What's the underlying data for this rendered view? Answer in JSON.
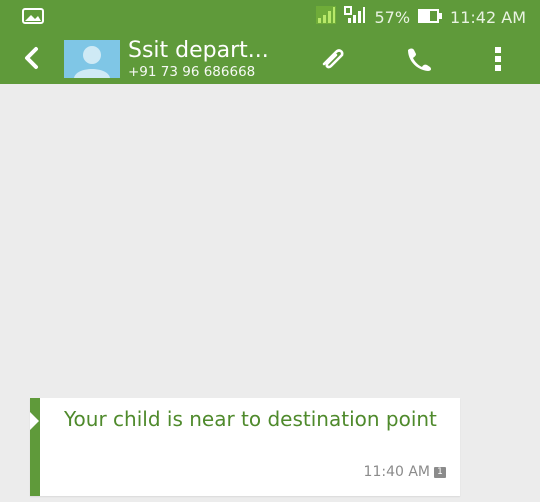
{
  "status_bar": {
    "battery": "57%",
    "time": "11:42 AM",
    "icons": [
      "gallery-notification-icon",
      "signal-sim1-icon",
      "signal-sim2-icon",
      "battery-icon"
    ]
  },
  "app_bar": {
    "contact_name": "Ssit depart...",
    "contact_number": "+91 73 96 686668",
    "icons": [
      "back-icon",
      "avatar-icon",
      "attach-icon",
      "call-icon",
      "overflow-menu-icon"
    ]
  },
  "messages": [
    {
      "text": "Your child is near to destination point",
      "time": "11:40 AM",
      "sim": "1"
    }
  ],
  "colors": {
    "accent": "#5f9a3a",
    "message_text": "#4f8a2c",
    "background": "#ececec"
  }
}
